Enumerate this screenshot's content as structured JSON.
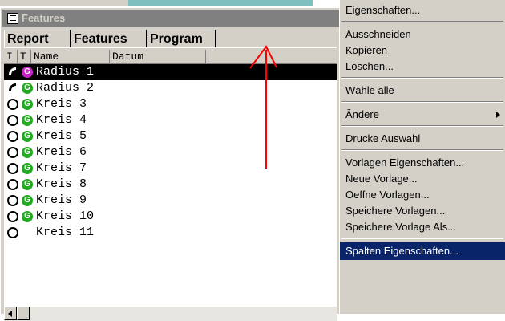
{
  "window": {
    "title": "Features"
  },
  "tabs": [
    "Report",
    "Features",
    "Program"
  ],
  "columns": [
    "I",
    "T",
    "Name",
    "Datum"
  ],
  "rows": [
    {
      "name": "Radius 1",
      "status": "arc",
      "type": "G",
      "type_color": "#cc22cc",
      "selected": true
    },
    {
      "name": "Radius 2",
      "status": "arc",
      "type": "G",
      "type_color": "#22aa22",
      "selected": false
    },
    {
      "name": "Kreis 3",
      "status": "circle",
      "type": "G",
      "type_color": "#22aa22",
      "selected": false
    },
    {
      "name": "Kreis 4",
      "status": "circle",
      "type": "G",
      "type_color": "#22aa22",
      "selected": false
    },
    {
      "name": "Kreis 5",
      "status": "circle",
      "type": "G",
      "type_color": "#22aa22",
      "selected": false
    },
    {
      "name": "Kreis 6",
      "status": "circle",
      "type": "G",
      "type_color": "#22aa22",
      "selected": false
    },
    {
      "name": "Kreis 7",
      "status": "circle",
      "type": "G",
      "type_color": "#22aa22",
      "selected": false
    },
    {
      "name": "Kreis 8",
      "status": "circle",
      "type": "G",
      "type_color": "#22aa22",
      "selected": false
    },
    {
      "name": "Kreis 9",
      "status": "circle",
      "type": "G",
      "type_color": "#22aa22",
      "selected": false
    },
    {
      "name": "Kreis 10",
      "status": "circle",
      "type": "G",
      "type_color": "#22aa22",
      "selected": false
    },
    {
      "name": "Kreis 11",
      "status": "circle",
      "type": "",
      "type_color": "",
      "selected": false
    }
  ],
  "context_menu": {
    "items": [
      {
        "label": "Eigenschaften...",
        "submenu": false,
        "highlighted": false
      },
      {
        "separator": true
      },
      {
        "label": "Ausschneiden",
        "submenu": false,
        "highlighted": false
      },
      {
        "label": "Kopieren",
        "submenu": false,
        "highlighted": false
      },
      {
        "label": "Löschen...",
        "submenu": false,
        "highlighted": false
      },
      {
        "separator": true
      },
      {
        "label": "Wähle alle",
        "submenu": false,
        "highlighted": false
      },
      {
        "separator": true
      },
      {
        "label": "Ändere",
        "submenu": true,
        "highlighted": false
      },
      {
        "separator": true
      },
      {
        "label": "Drucke Auswahl",
        "submenu": false,
        "highlighted": false
      },
      {
        "separator": true
      },
      {
        "label": "Vorlagen Eigenschaften...",
        "submenu": false,
        "highlighted": false
      },
      {
        "label": "Neue Vorlage...",
        "submenu": false,
        "highlighted": false
      },
      {
        "label": "Oeffne Vorlagen...",
        "submenu": false,
        "highlighted": false
      },
      {
        "label": "Speichere Vorlagen...",
        "submenu": false,
        "highlighted": false
      },
      {
        "label": "Speichere Vorlage Als...",
        "submenu": false,
        "highlighted": false
      },
      {
        "separator": true
      },
      {
        "label": "Spalten Eigenschaften...",
        "submenu": false,
        "highlighted": true
      }
    ]
  },
  "colors": {
    "selection": "#000000",
    "menu_highlight": "#0a246a",
    "annotation_arrow": "#ff0000",
    "title_bar": "#808080"
  }
}
